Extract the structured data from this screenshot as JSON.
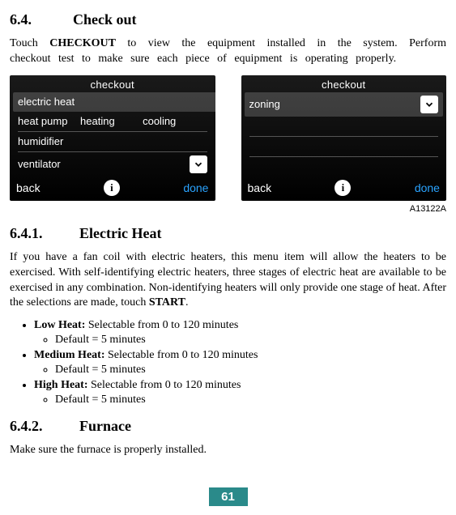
{
  "section64": {
    "num": "6.4.",
    "title": "Check out"
  },
  "p1a": "Touch ",
  "p1b": "CHECKOUT",
  "p1c": " to view the equipment installed in the system. Perform checkout test to make sure each piece of equipment is operating properly.",
  "panelLeft": {
    "title": "checkout",
    "r1": "electric heat",
    "r2a": "heat pump",
    "r2b": "heating",
    "r2c": "cooling",
    "r3": "humidifier",
    "r4": "ventilator",
    "back": "back",
    "done": "done"
  },
  "panelRight": {
    "title": "checkout",
    "r1": "zoning",
    "back": "back",
    "done": "done"
  },
  "figLabel": "A13122A",
  "section641": {
    "num": "6.4.1.",
    "title": "Electric Heat"
  },
  "p2a": "If you have a fan coil with electric heaters, this menu item will allow the heaters to be exercised. With self-identifying electric heaters, three stages of electric heat are available to be exercised in any combination. Non-identifying heaters will only provide one stage of heat. After the selections are made, touch ",
  "p2b": "START",
  "p2c": ".",
  "b1a": "Low Heat:",
  "b1b": " Selectable from 0 to 120 minutes",
  "b1s": "Default = 5 minutes",
  "b2a": "Medium Heat:",
  "b2b": " Selectable from 0 to 120 minutes",
  "b2s": "Default = 5 minutes",
  "b3a": "High Heat:",
  "b3b": " Selectable from 0 to 120 minutes",
  "b3s": "Default = 5 minutes",
  "section642": {
    "num": "6.4.2.",
    "title": "Furnace"
  },
  "p3": "Make sure the furnace is properly installed.",
  "pageNumber": "61"
}
